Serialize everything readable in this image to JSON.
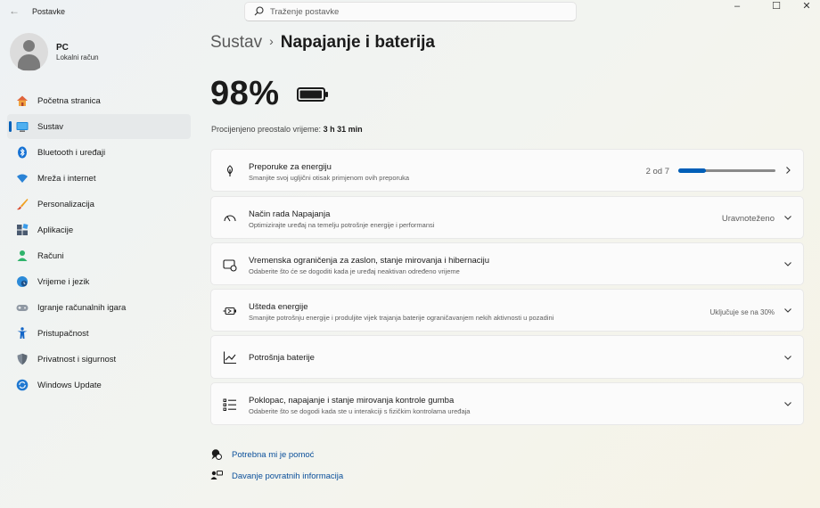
{
  "window": {
    "title": "Postavke",
    "back_icon": "back-arrow-icon",
    "minimize_glyph": "–",
    "maximize_glyph": "☐",
    "close_glyph": "✕"
  },
  "search": {
    "placeholder": "Traženje postavke",
    "icon": "search-icon"
  },
  "user": {
    "name": "PC",
    "account_type": "Lokalni račun"
  },
  "sidebar": {
    "items": [
      {
        "label": "Početna stranica",
        "icon": "home-icon",
        "active": false
      },
      {
        "label": "Sustav",
        "icon": "system-monitor-icon",
        "active": true
      },
      {
        "label": "Bluetooth i uređaji",
        "icon": "bluetooth-icon",
        "active": false
      },
      {
        "label": "Mreža i internet",
        "icon": "wifi-icon",
        "active": false
      },
      {
        "label": "Personalizacija",
        "icon": "brush-icon",
        "active": false
      },
      {
        "label": "Aplikacije",
        "icon": "apps-icon",
        "active": false
      },
      {
        "label": "Računi",
        "icon": "account-icon",
        "active": false
      },
      {
        "label": "Vrijeme i jezik",
        "icon": "globe-clock-icon",
        "active": false
      },
      {
        "label": "Igranje računalnih igara",
        "icon": "gamepad-icon",
        "active": false
      },
      {
        "label": "Pristupačnost",
        "icon": "accessibility-icon",
        "active": false
      },
      {
        "label": "Privatnost i sigurnost",
        "icon": "shield-icon",
        "active": false
      },
      {
        "label": "Windows Update",
        "icon": "windows-update-icon",
        "active": false
      }
    ]
  },
  "breadcrumb": {
    "parent": "Sustav",
    "separator": "›",
    "current": "Napajanje i baterija"
  },
  "battery": {
    "percent_text": "98%",
    "level": 0.98,
    "estimate_label": "Procijenjeno preostalo vrijeme:",
    "estimate_value": "3 h 31 min"
  },
  "cards": {
    "energy_recs": {
      "title": "Preporuke za energiju",
      "subtitle": "Smanjite svoj ugljični otisak primjenom ovih preporuka",
      "count_text": "2 od 7",
      "progress_fraction": 0.2857,
      "icon": "leaf-icon"
    },
    "power_mode": {
      "title": "Način rada Napajanja",
      "subtitle": "Optimizirajte uređaj na temelju potrošnje energije i performansi",
      "value": "Uravnoteženo",
      "icon": "power-mode-gauge-icon"
    },
    "screen_sleep": {
      "title": "Vremenska ograničenja za zaslon, stanje mirovanja i hibernaciju",
      "subtitle": "Odaberite što će se dogoditi kada je uređaj neaktivan određeno vrijeme",
      "icon": "screen-sleep-icon"
    },
    "energy_saver": {
      "title": "Ušteda energije",
      "subtitle": "Smanjite potrošnju energije i produljite vijek trajanja baterije ograničavanjem nekih aktivnosti u pozadini",
      "value": "Uključuje se na 30%",
      "icon": "battery-saver-icon"
    },
    "battery_usage": {
      "title": "Potrošnja baterije",
      "icon": "usage-chart-icon"
    },
    "lid_buttons": {
      "title": "Poklopac, napajanje i stanje mirovanja kontrole gumba",
      "subtitle": "Odaberite što se dogodi kada ste u interakciji s fizičkim kontrolama uređaja",
      "icon": "lid-controls-icon"
    }
  },
  "footer": {
    "help_label": "Potrebna mi je pomoć",
    "feedback_label": "Davanje povratnih informacija"
  },
  "colors": {
    "accent": "#005fb8",
    "link": "#0a4f9a"
  }
}
